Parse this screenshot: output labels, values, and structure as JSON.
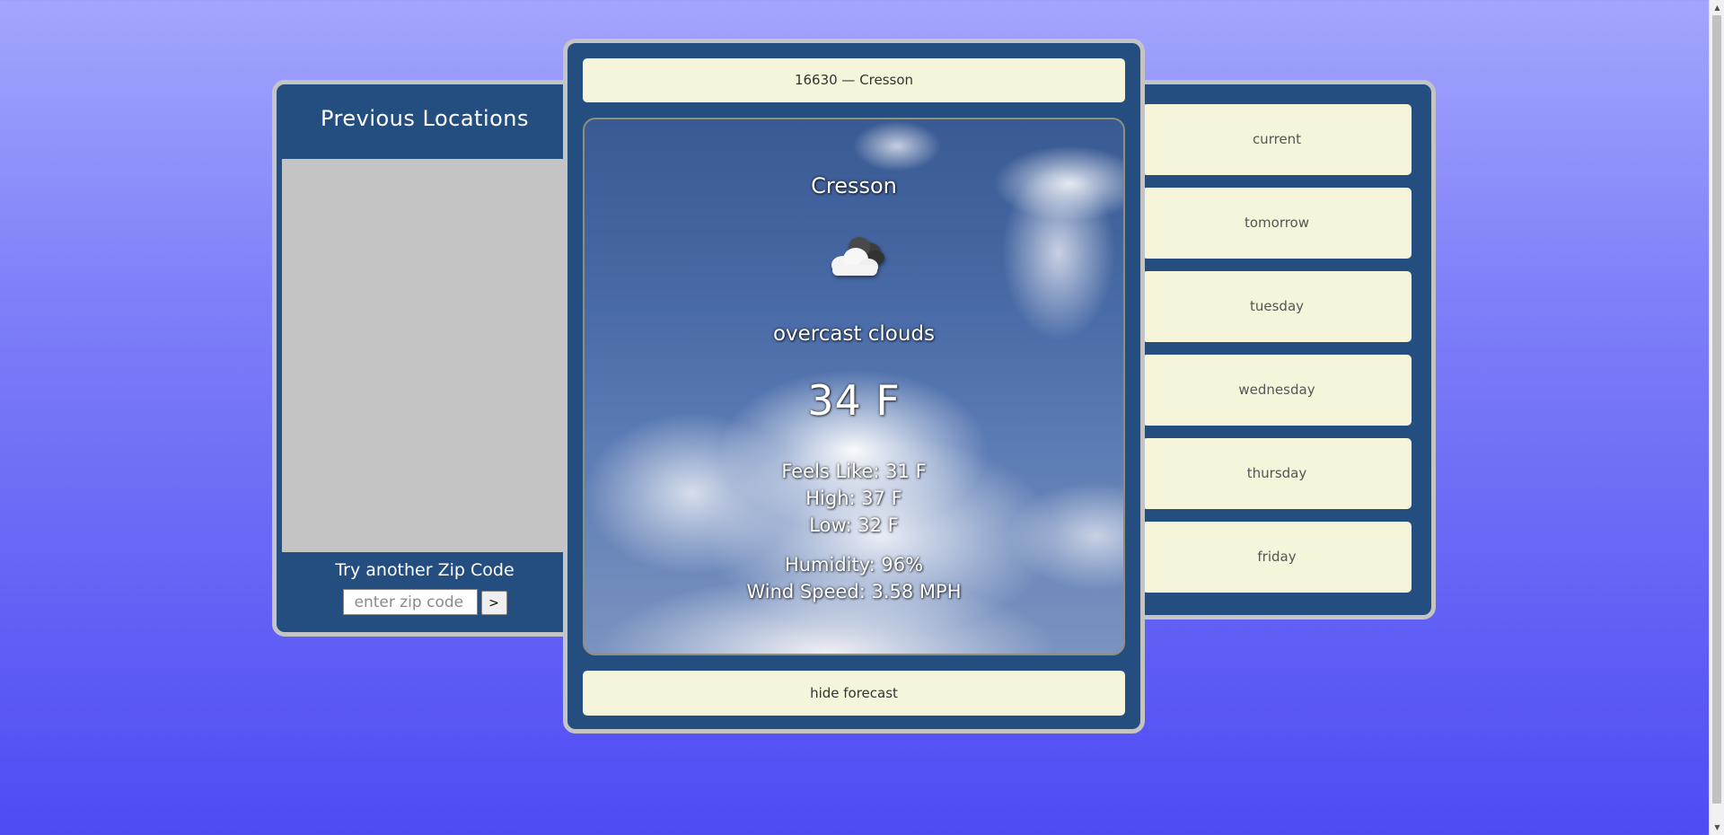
{
  "left_panel": {
    "title": "Previous Locations",
    "zip_label": "Try another Zip Code",
    "zip_placeholder": "enter zip code",
    "submit_label": ">"
  },
  "center": {
    "location_bar": "16630 — Cresson",
    "city": "Cresson",
    "weather_icon": "overcast-cloud-icon",
    "description": "overcast clouds",
    "temperature": "34 F",
    "feels_like": "Feels Like: 31 F",
    "high": "High: 37 F",
    "low": "Low: 32 F",
    "humidity": "Humidity: 96%",
    "wind_speed": "Wind Speed: 3.58 MPH",
    "hide_label": "hide forecast"
  },
  "forecast_days": [
    {
      "label": "current"
    },
    {
      "label": "tomorrow"
    },
    {
      "label": "tuesday"
    },
    {
      "label": "wednesday"
    },
    {
      "label": "thursday"
    },
    {
      "label": "friday"
    }
  ],
  "colors": {
    "panel": "#254e80",
    "panel_border": "#c4c4c4",
    "button_bg": "#f5f5dc",
    "list_bg": "#c4c4c4"
  }
}
